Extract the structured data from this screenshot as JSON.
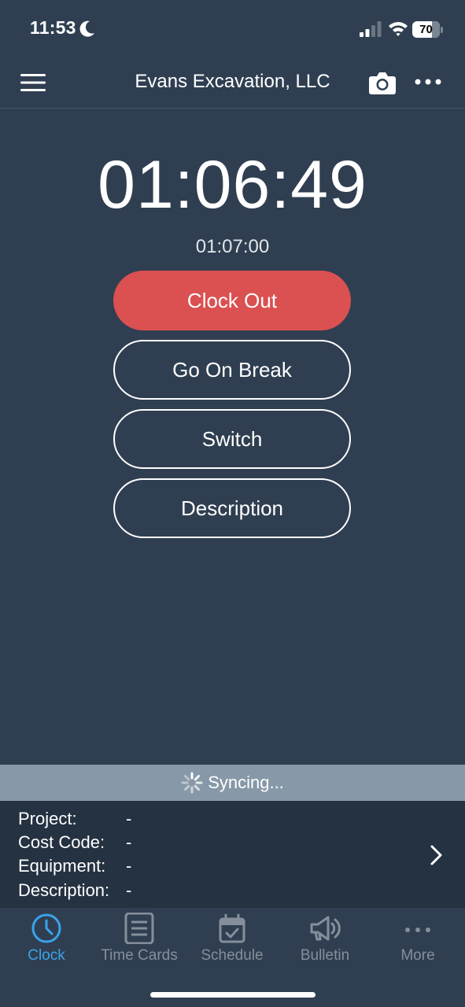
{
  "status_bar": {
    "time": "11:53",
    "battery": "70"
  },
  "header": {
    "title": "Evans Excavation, LLC"
  },
  "timer": {
    "elapsed": "01:06:49",
    "total": "01:07:00"
  },
  "actions": {
    "clock_out": "Clock Out",
    "go_on_break": "Go On Break",
    "switch": "Switch",
    "description": "Description"
  },
  "sync": {
    "label": "Syncing..."
  },
  "details": {
    "project_label": "Project:",
    "project_value": "-",
    "cost_code_label": "Cost Code:",
    "cost_code_value": "-",
    "equipment_label": "Equipment:",
    "equipment_value": "-",
    "description_label": "Description:",
    "description_value": "-"
  },
  "tabs": [
    {
      "label": "Clock",
      "icon": "clock-icon",
      "active": true
    },
    {
      "label": "Time Cards",
      "icon": "document-icon",
      "active": false
    },
    {
      "label": "Schedule",
      "icon": "calendar-check-icon",
      "active": false
    },
    {
      "label": "Bulletin",
      "icon": "megaphone-icon",
      "active": false
    },
    {
      "label": "More",
      "icon": "more-dots-icon",
      "active": false
    }
  ],
  "colors": {
    "background": "#2f3f51",
    "clock_out": "#db5050",
    "active_tab": "#3aa3eb",
    "inactive_tab": "#858f9b",
    "sync_bar": "#8799a8",
    "info_panel": "#243242"
  }
}
